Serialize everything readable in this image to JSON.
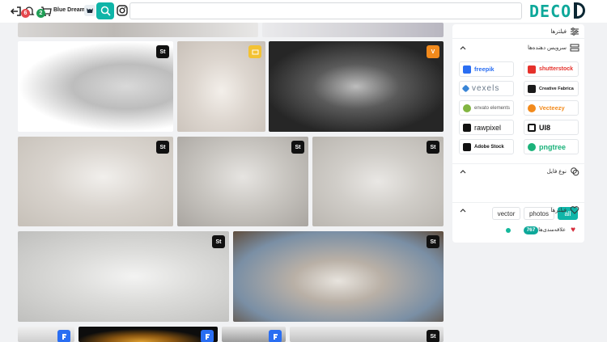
{
  "topbar": {
    "notif_count_1": "6",
    "notif_count_2": "2",
    "username": "Blue Dream",
    "search_value": "",
    "logo_text": "DECO"
  },
  "sidebar": {
    "filters_title": "فیلترها",
    "sources_title": "سرویس دهنده‌ها",
    "sources": [
      {
        "label": "freepik",
        "color": "#2a6ef2"
      },
      {
        "label": "shutterstock",
        "color": "#e5312b"
      },
      {
        "label": "vexels",
        "color": "#3a85d6"
      },
      {
        "label": "Creative Fabrica",
        "color": "#1a1a1a"
      },
      {
        "label": "envato elements",
        "color": "#82b541"
      },
      {
        "label": "Vecteezy",
        "color": "#f28a1c"
      },
      {
        "label": "rawpixel",
        "color": "#111111"
      },
      {
        "label": "UI8",
        "color": "#111111"
      },
      {
        "label": "Adobe Stock",
        "color": "#111111"
      },
      {
        "label": "pngtree",
        "color": "#1bb27a"
      }
    ],
    "file_type_title": "نوع فایل",
    "file_types": [
      "vector",
      "photos",
      "all"
    ],
    "favorites_title": "فیلترها",
    "favorites_label": "علاقه‌مندی‌ها",
    "favorites_count": "767"
  },
  "tiles": [
    {
      "tag": "St"
    },
    {
      "tag": "yl"
    },
    {
      "tag": "V"
    },
    {
      "tag": "St"
    },
    {
      "tag": "St"
    },
    {
      "tag": "St"
    },
    {
      "tag": "St"
    },
    {
      "tag": "St"
    },
    {
      "tag": "fp"
    },
    {
      "tag": "fp"
    },
    {
      "tag": "fp"
    },
    {
      "tag": "St"
    }
  ],
  "colors": {
    "accent": "#10b5a8",
    "logo": "#0ea89a"
  }
}
